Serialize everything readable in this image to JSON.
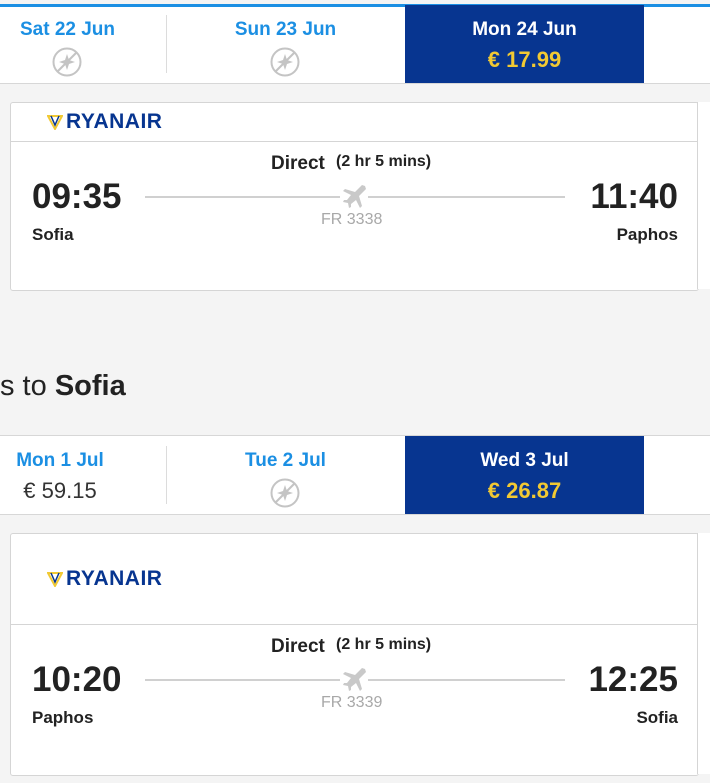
{
  "outbound": {
    "dates": [
      {
        "label": "Sat 22 Jun",
        "price": null
      },
      {
        "label": "Sun 23 Jun",
        "price": null
      },
      {
        "label": "Mon 24 Jun",
        "price": "€ 17.99",
        "selected": true
      }
    ],
    "flight": {
      "airline": "RYANAIR",
      "direct_label": "Direct",
      "duration": "(2 hr 5 mins)",
      "depart_time": "09:35",
      "depart_city": "Sofia",
      "arrive_time": "11:40",
      "arrive_city": "Paphos",
      "flight_number": "FR 3338"
    }
  },
  "return_heading": {
    "prefix": "s to ",
    "destination": "Sofia"
  },
  "return": {
    "dates": [
      {
        "label": "Mon 1 Jul",
        "price": "€ 59.15"
      },
      {
        "label": "Tue 2 Jul",
        "price": null
      },
      {
        "label": "Wed 3 Jul",
        "price": "€ 26.87",
        "selected": true
      }
    ],
    "flight": {
      "airline": "RYANAIR",
      "direct_label": "Direct",
      "duration": "(2 hr 5 mins)",
      "depart_time": "10:20",
      "depart_city": "Paphos",
      "arrive_time": "12:25",
      "arrive_city": "Sofia",
      "flight_number": "FR 3339"
    }
  },
  "colors": {
    "brand_blue": "#073590",
    "accent_blue": "#1b8fe3",
    "price_yellow": "#f1c933"
  }
}
